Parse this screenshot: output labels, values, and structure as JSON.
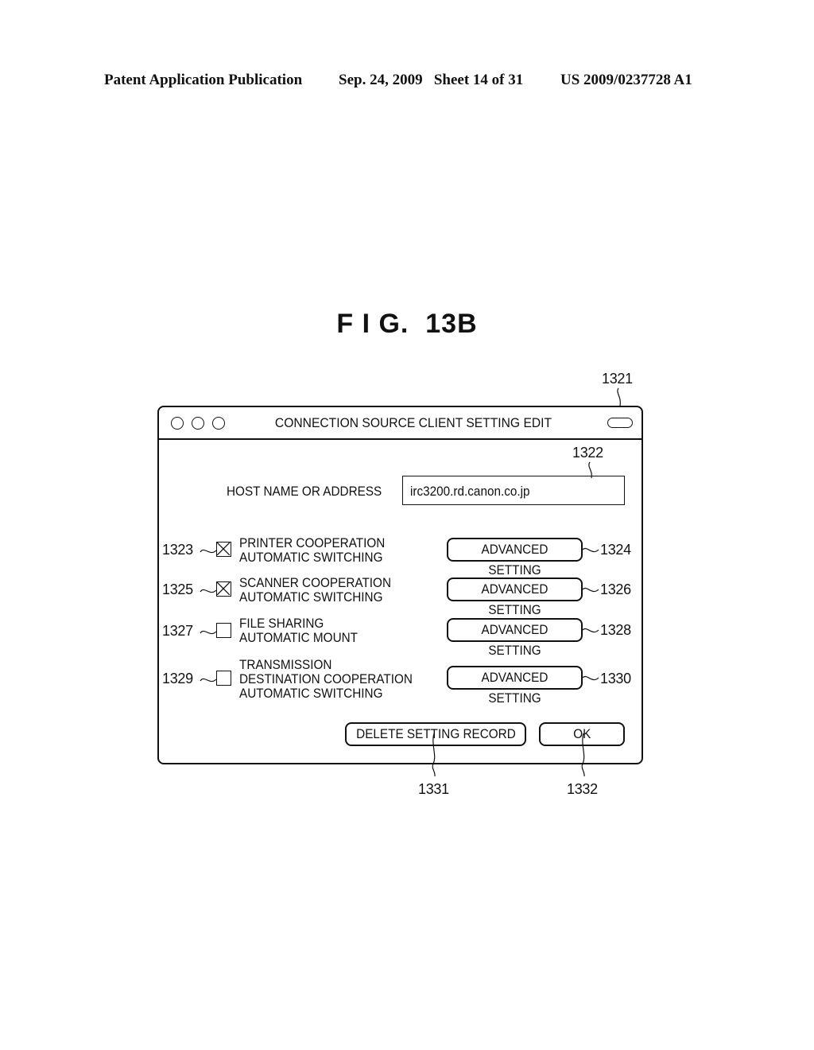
{
  "header": {
    "publication": "Patent Application Publication",
    "date_sheet": "Sep. 24, 2009   Sheet 14 of 31",
    "patent_number": "US 2009/0237728 A1"
  },
  "figure_title": "F I G.  13B",
  "window": {
    "ref": "1321",
    "title": "CONNECTION SOURCE CLIENT SETTING EDIT",
    "host": {
      "label": "HOST NAME OR ADDRESS",
      "value": "irc3200.rd.canon.co.jp",
      "ref": "1322"
    },
    "options": [
      {
        "ref": "1323",
        "checked": true,
        "lines": [
          "PRINTER COOPERATION",
          "AUTOMATIC SWITCHING"
        ],
        "button": "ADVANCED SETTING",
        "button_ref": "1324"
      },
      {
        "ref": "1325",
        "checked": true,
        "lines": [
          "SCANNER COOPERATION",
          "AUTOMATIC SWITCHING"
        ],
        "button": "ADVANCED SETTING",
        "button_ref": "1326"
      },
      {
        "ref": "1327",
        "checked": false,
        "lines": [
          "FILE SHARING",
          "AUTOMATIC MOUNT"
        ],
        "button": "ADVANCED SETTING",
        "button_ref": "1328"
      },
      {
        "ref": "1329",
        "checked": false,
        "lines": [
          "TRANSMISSION",
          "DESTINATION COOPERATION",
          "AUTOMATIC SWITCHING"
        ],
        "button": "ADVANCED SETTING",
        "button_ref": "1330"
      }
    ],
    "delete_button": {
      "label": "DELETE SETTING RECORD",
      "ref": "1331"
    },
    "ok_button": {
      "label": "OK",
      "ref": "1332"
    }
  }
}
